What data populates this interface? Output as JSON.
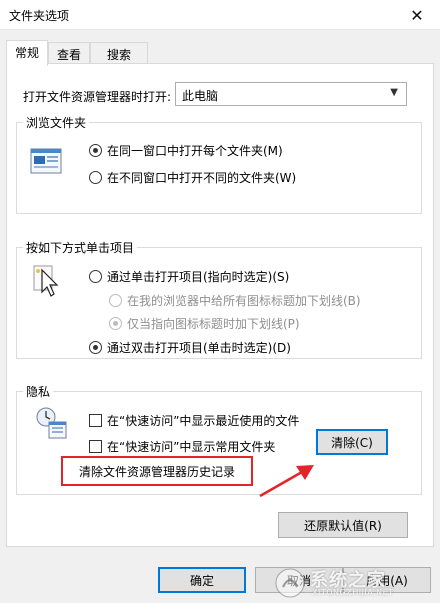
{
  "window": {
    "title": "文件夹选项",
    "close_glyph": "✕"
  },
  "tabs": [
    {
      "label": "常规",
      "active": true
    },
    {
      "label": "查看",
      "active": false
    },
    {
      "label": "搜索",
      "active": false
    }
  ],
  "open_explorer": {
    "label": "打开文件资源管理器时打开:",
    "value": "此电脑"
  },
  "browse_folders": {
    "title": "浏览文件夹",
    "options": [
      {
        "label": "在同一窗口中打开每个文件夹(M)",
        "checked": true
      },
      {
        "label": "在不同窗口中打开不同的文件夹(W)",
        "checked": false
      }
    ]
  },
  "click_items": {
    "title": "按如下方式单击项目",
    "options": [
      {
        "label": "通过单击打开项目(指向时选定)(S)",
        "checked": false,
        "disabled": false
      },
      {
        "label": "在我的浏览器中给所有图标标题加下划线(B)",
        "checked": false,
        "disabled": true
      },
      {
        "label": "仅当指向图标标题时加下划线(P)",
        "checked": true,
        "disabled": true
      },
      {
        "label": "通过双击打开项目(单击时选定)(D)",
        "checked": true,
        "disabled": false
      }
    ]
  },
  "privacy": {
    "title": "隐私",
    "options": [
      {
        "label": "在“快速访问”中显示最近使用的文件",
        "checked": false
      },
      {
        "label": "在“快速访问”中显示常用文件夹",
        "checked": false
      }
    ],
    "clear_history_label": "清除文件资源管理器历史记录",
    "clear_button": "清除(C)"
  },
  "restore_defaults_button": "还原默认值(R)",
  "footer": {
    "ok": "确定",
    "cancel": "取消",
    "apply": "应用(A)"
  },
  "watermark": {
    "name": "系统之家",
    "url": "XITONGZHIJIA.NET"
  },
  "colors": {
    "annotation_red": "#e3242b",
    "focus_blue": "#0078d7"
  }
}
